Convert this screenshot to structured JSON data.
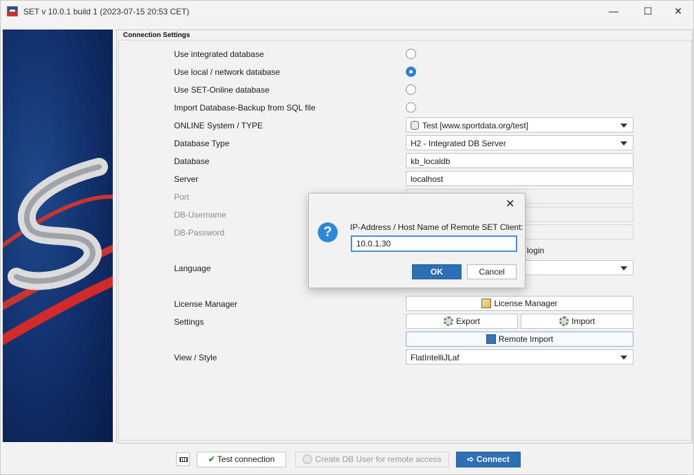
{
  "window": {
    "title": "SET v 10.0.1 build 1 (2023-07-15 20:53 CET)",
    "minimize_glyph": "—",
    "maximize_glyph": "☐",
    "close_glyph": "✕"
  },
  "panel": {
    "title": "Connection Settings",
    "options": [
      {
        "label": "Use integrated database",
        "checked": false
      },
      {
        "label": "Use local / network database",
        "checked": true
      },
      {
        "label": "Use SET-Online database",
        "checked": false
      },
      {
        "label": "Import Database-Backup from SQL file",
        "checked": false
      }
    ],
    "online_system": {
      "label": "ONLINE System / TYPE",
      "value": "Test [www.sportdata.org/test]"
    },
    "database_type": {
      "label": "Database Type",
      "value": "H2 - Integrated DB Server"
    },
    "database": {
      "label": "Database",
      "value": "kb_localdb"
    },
    "server": {
      "label": "Server",
      "value": "localhost"
    },
    "port": {
      "label": "Port",
      "value": ""
    },
    "db_username": {
      "label": "DB-Username",
      "value": ""
    },
    "db_password": {
      "label": "DB-Password",
      "value": ""
    },
    "login_fragment": "login",
    "language": {
      "label": "Language",
      "value": ""
    },
    "license_manager": {
      "label": "License Manager",
      "button": "License Manager"
    },
    "settings": {
      "label": "Settings",
      "export_button": "Export",
      "import_button": "Import",
      "remote_import_button": "Remote Import"
    },
    "view_style": {
      "label": "View / Style",
      "value": "FlatIntelliJLaf"
    }
  },
  "dialog": {
    "close_glyph": "✕",
    "question_glyph": "?",
    "prompt": "IP-Address / Host Name of Remote SET Client:",
    "input_value": "10.0.1.30",
    "ok_button": "OK",
    "cancel_button": "Cancel"
  },
  "bottom": {
    "test_connection": "Test connection",
    "create_db_user": "Create DB User for remote access",
    "connect": "Connect",
    "check_glyph": "✔",
    "connect_glyph": "➪"
  },
  "colors": {
    "accent": "#2d6fb4",
    "radio_checked": "#2f7fd6",
    "banner_blue": "#123270",
    "banner_red": "#d22a2a"
  }
}
